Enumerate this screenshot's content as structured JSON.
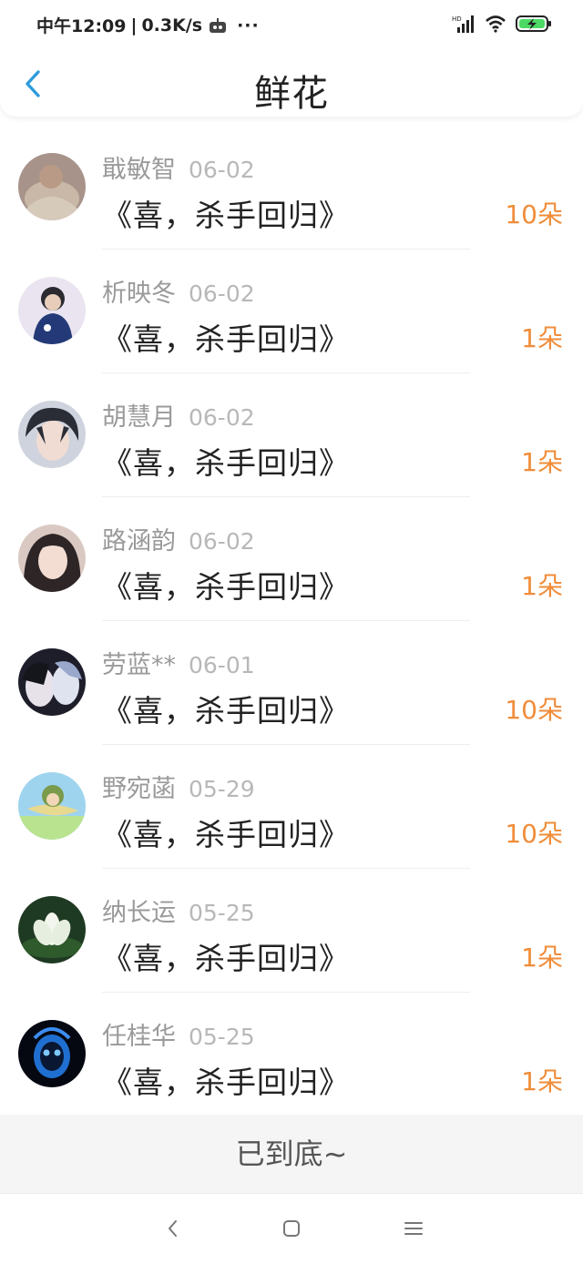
{
  "status_bar": {
    "time": "中午12:09",
    "speed": "0.3K/s",
    "more": "···",
    "network_badge": "HD"
  },
  "header": {
    "title": "鲜花"
  },
  "items": [
    {
      "name": "戢敏智",
      "date": "06-02",
      "title": "《喜，杀手回归》",
      "count": "10朵",
      "avatar": "avatar-1"
    },
    {
      "name": "析映冬",
      "date": "06-02",
      "title": "《喜，杀手回归》",
      "count": "1朵",
      "avatar": "avatar-2"
    },
    {
      "name": "胡慧月",
      "date": "06-02",
      "title": "《喜，杀手回归》",
      "count": "1朵",
      "avatar": "avatar-3"
    },
    {
      "name": "路涵韵",
      "date": "06-02",
      "title": "《喜，杀手回归》",
      "count": "1朵",
      "avatar": "avatar-4"
    },
    {
      "name": "劳蓝**",
      "date": "06-01",
      "title": "《喜，杀手回归》",
      "count": "10朵",
      "avatar": "avatar-5"
    },
    {
      "name": "野宛菡",
      "date": "05-29",
      "title": "《喜，杀手回归》",
      "count": "10朵",
      "avatar": "avatar-6"
    },
    {
      "name": "纳长运",
      "date": "05-25",
      "title": "《喜，杀手回归》",
      "count": "1朵",
      "avatar": "avatar-7"
    },
    {
      "name": "任桂华",
      "date": "05-25",
      "title": "《喜，杀手回归》",
      "count": "1朵",
      "avatar": "avatar-8"
    }
  ],
  "footer": {
    "end_text": "已到底~"
  },
  "colors": {
    "accent": "#2d9cdb",
    "count": "#f08d3a"
  }
}
